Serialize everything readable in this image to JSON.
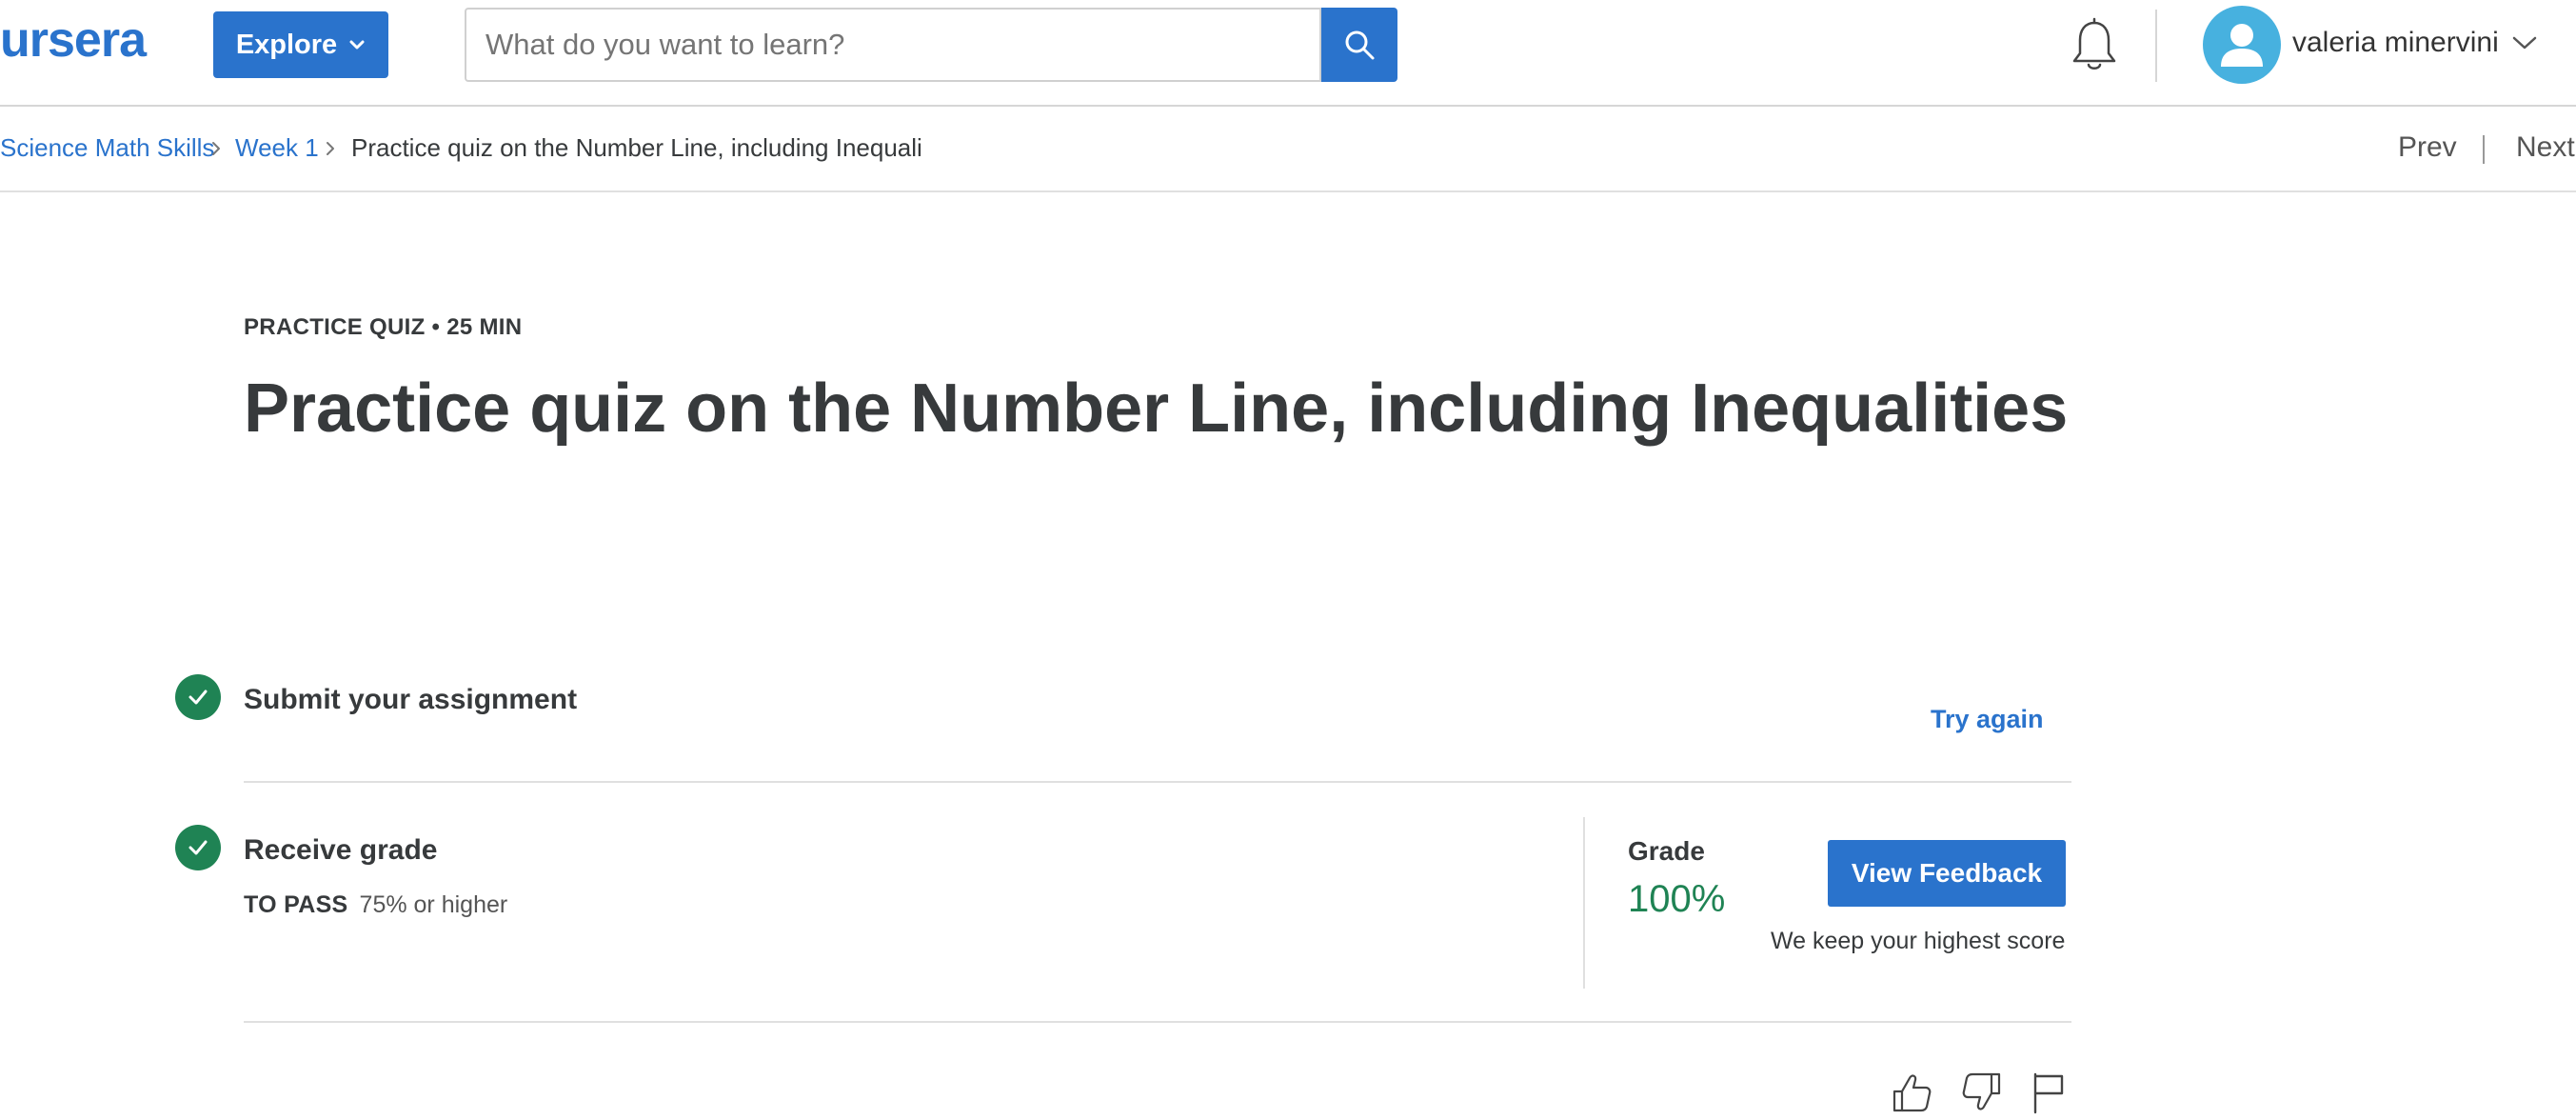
{
  "header": {
    "logo_text": "ursera",
    "explore_label": "Explore",
    "search_placeholder": "What do you want to learn?",
    "user_name": "valeria minervini"
  },
  "breadcrumb": {
    "items": [
      "Science Math Skills",
      "Week 1"
    ],
    "current": "Practice quiz on the Number Line, including Inequaliti",
    "prev_label": "Prev",
    "next_label": "Next"
  },
  "quiz": {
    "meta": "PRACTICE QUIZ • 25 MIN",
    "title": "Practice quiz on the Number Line, including Inequalities"
  },
  "steps": {
    "submit": {
      "label": "Submit your assignment",
      "action_label": "Try again"
    },
    "grade": {
      "label": "Receive grade",
      "to_pass_label": "TO PASS",
      "to_pass_value": "75% or higher",
      "grade_label": "Grade",
      "grade_value": "100%",
      "feedback_button": "View Feedback",
      "note": "We keep your highest score"
    }
  },
  "icons": {
    "search": "search-icon",
    "bell": "bell-icon",
    "avatar": "user-avatar-icon",
    "check": "check-circle-icon",
    "like": "thumbs-up-icon",
    "dislike": "thumbs-down-icon",
    "flag": "flag-icon"
  },
  "colors": {
    "brand_blue": "#2a73cc",
    "success_green": "#1f8354",
    "avatar_blue": "#47b1df",
    "text_dark": "#373a3c"
  }
}
